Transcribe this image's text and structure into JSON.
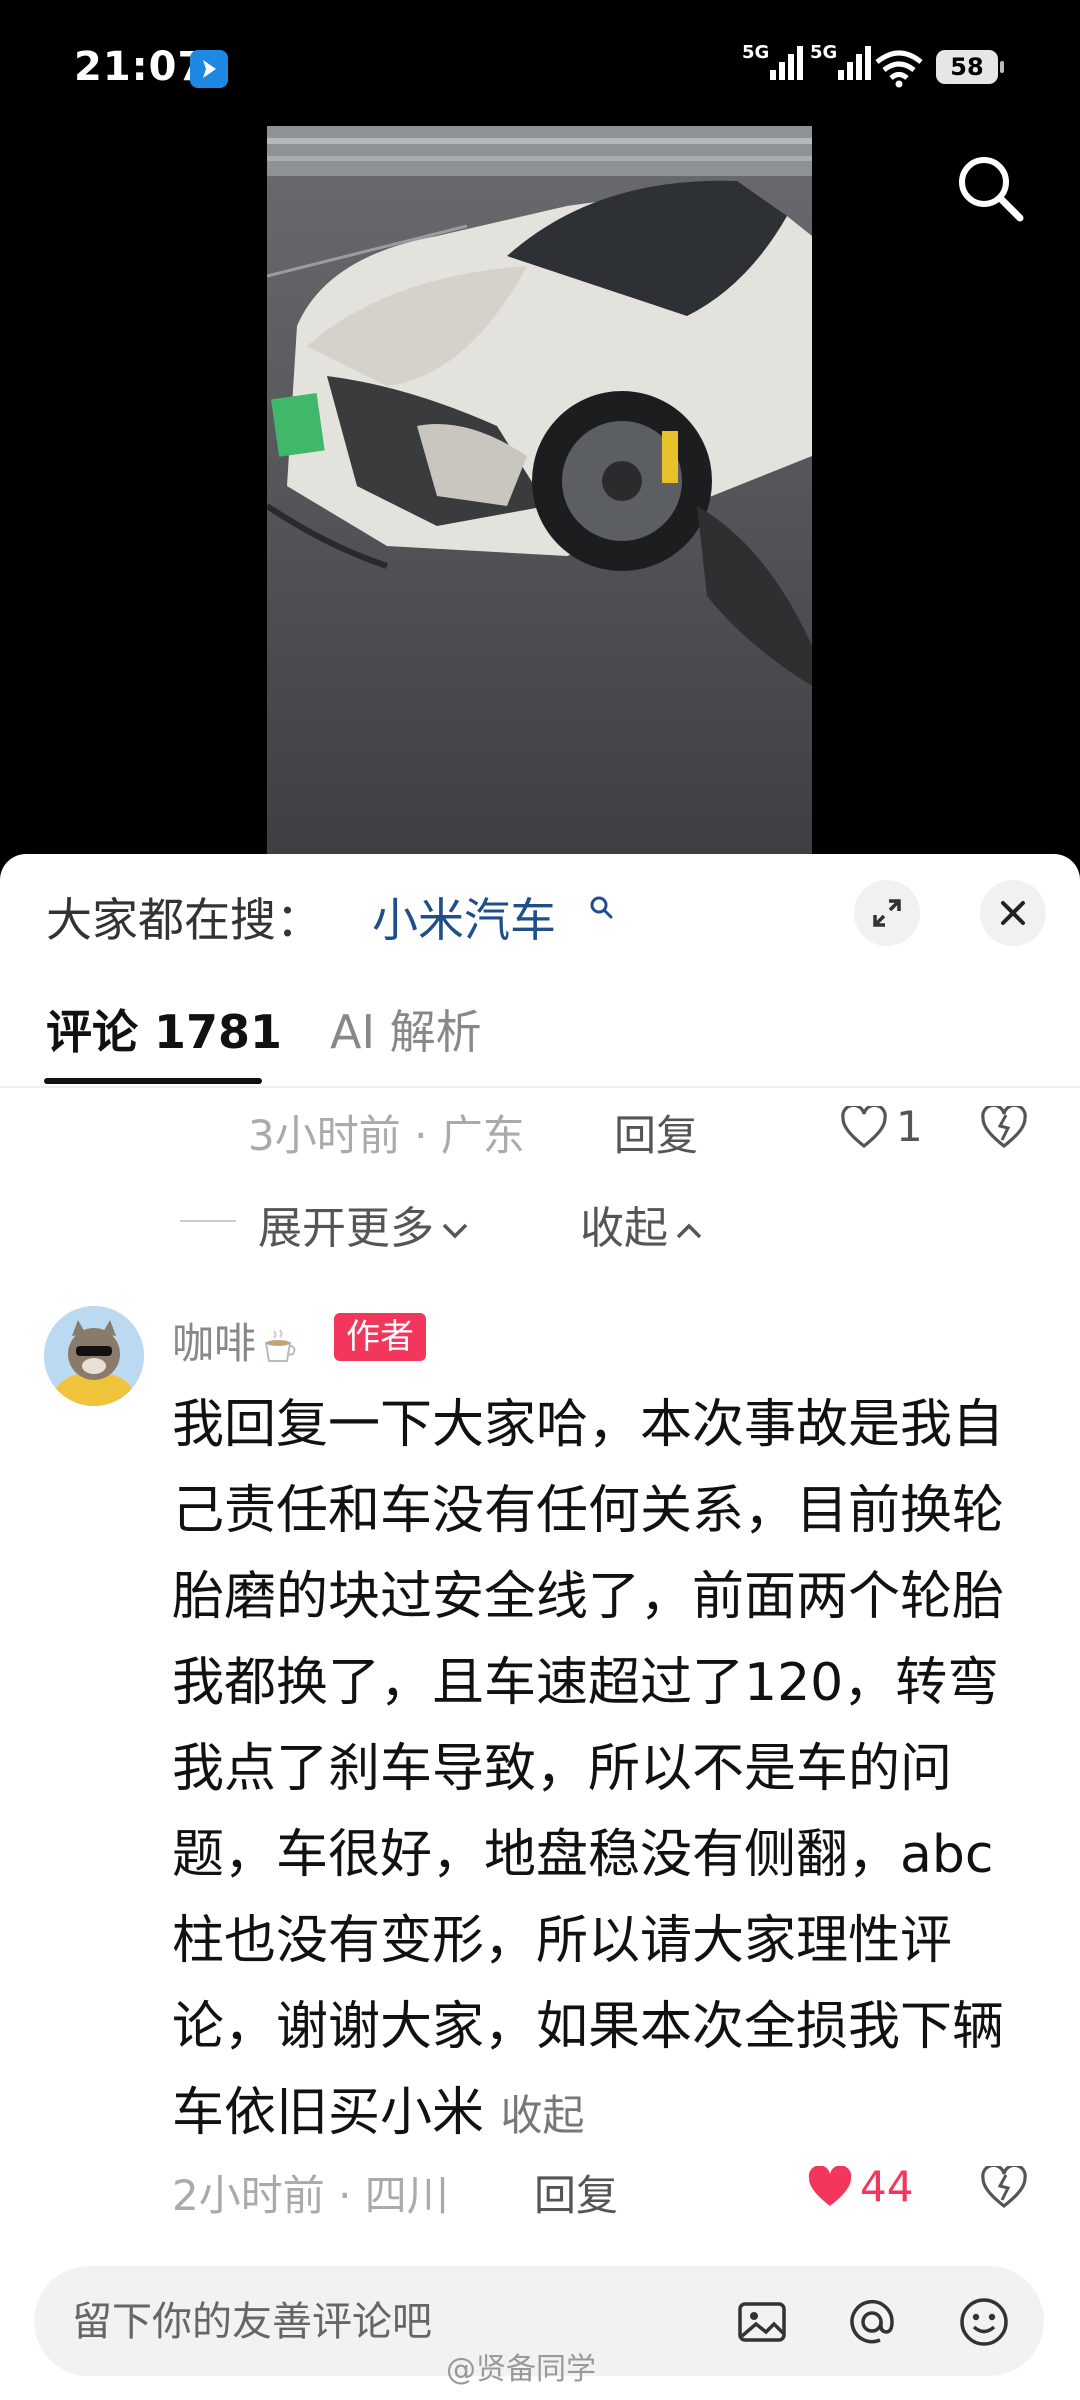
{
  "status_bar": {
    "time": "21:07",
    "sig1": "5G",
    "sig2": "5G",
    "battery": "58"
  },
  "sheet": {
    "hot_search_prefix": "大家都在搜：",
    "hot_search_term": "小米汽车"
  },
  "tabs": {
    "comments": "评论 1781",
    "ai": "AI 解析"
  },
  "reply_meta": {
    "time_location": "3小时前 · 广东",
    "reply": "回复",
    "likes": "1"
  },
  "thread": {
    "expand_more": "展开更多",
    "collapse": "收起"
  },
  "comment": {
    "username": "咖啡",
    "author_badge": "作者",
    "text": "我回复一下大家哈，本次事故是我自己责任和车没有任何关系，目前换轮胎磨的块过安全线了，前面两个轮胎我都换了，且车速超过了120，转弯我点了刹车导致，所以不是车的问题，车很好，地盘稳没有侧翻，abc柱也没有变形，所以请大家理性评论，谢谢大家，如果本次全损我下辆车依旧买小米",
    "collapse": "收起",
    "time_location": "2小时前 · 四川",
    "reply": "回复",
    "likes": "44"
  },
  "input": {
    "placeholder": "留下你的友善评论吧"
  },
  "watermark": "@贤备同学",
  "colors": {
    "link_blue": "#1f4f8a",
    "author_badge": "#f2365c",
    "like_red": "#f2365c"
  }
}
